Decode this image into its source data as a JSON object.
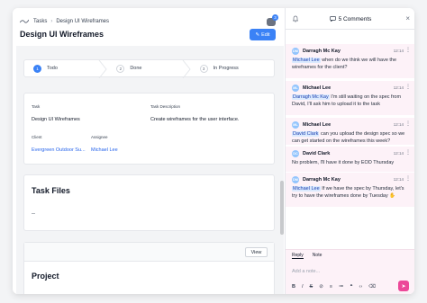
{
  "breadcrumb": {
    "root": "Tasks",
    "current": "Design UI Wireframes"
  },
  "notifications": {
    "count": "3"
  },
  "page": {
    "title": "Design UI Wireframes",
    "edit_label": "Edit"
  },
  "steps": [
    {
      "num": "1",
      "label": "Todo"
    },
    {
      "num": "2",
      "label": "Done"
    },
    {
      "num": "3",
      "label": "In Progress"
    }
  ],
  "task": {
    "task_label": "Task",
    "task_value": "Design UI Wireframes",
    "description_label": "Task Description",
    "description_value": "Create wireframes for the user interface.",
    "client_label": "Client",
    "client_value": "Evergreen Outdoor Su...",
    "assignee_label": "Assignee",
    "assignee_value": "Michael Lee"
  },
  "files": {
    "title": "Task Files",
    "placeholder": "--"
  },
  "project": {
    "title": "Project",
    "view_label": "View"
  },
  "comments_panel": {
    "title": "5 Comments",
    "items": [
      {
        "initials": "DM",
        "author": "Darragh Mc Kay",
        "time": "12:14",
        "mention": "Michael Lee",
        "text": " when do we think we will have the wireframes for the client?"
      },
      {
        "initials": "ML",
        "author": "Michael Lee",
        "time": "12:14",
        "mention": "Darragh Mc Kay",
        "text": " I'm still waiting on the spec from David, I'll ask him to upload it to the task"
      },
      {
        "initials": "ML",
        "author": "Michael Lee",
        "time": "12:14",
        "mention": "David Clark",
        "text": " can you upload the design spec so we can get started on the wireframes this week?"
      },
      {
        "initials": "DC",
        "author": "David Clark",
        "time": "12:14",
        "mention": "",
        "text": "No problem, I'll have it done by EOD Thursday"
      },
      {
        "initials": "DM",
        "author": "Darragh Mc Kay",
        "time": "12:14",
        "mention": "Michael Lee",
        "text": " If we have the spec by Thursday, let's try to have the wireframes done by Tuesday ✋"
      }
    ]
  },
  "reply": {
    "tab_reply": "Reply",
    "tab_note": "Note",
    "placeholder": "Add a note...",
    "toolbar": [
      "B",
      "I",
      "S",
      "⊘",
      "≡",
      "≔",
      "❝",
      "‹›",
      "⌫"
    ]
  },
  "colors": {
    "accent": "#3b82f6",
    "send": "#ec4899",
    "comment_bg": "#fdf2f8"
  }
}
